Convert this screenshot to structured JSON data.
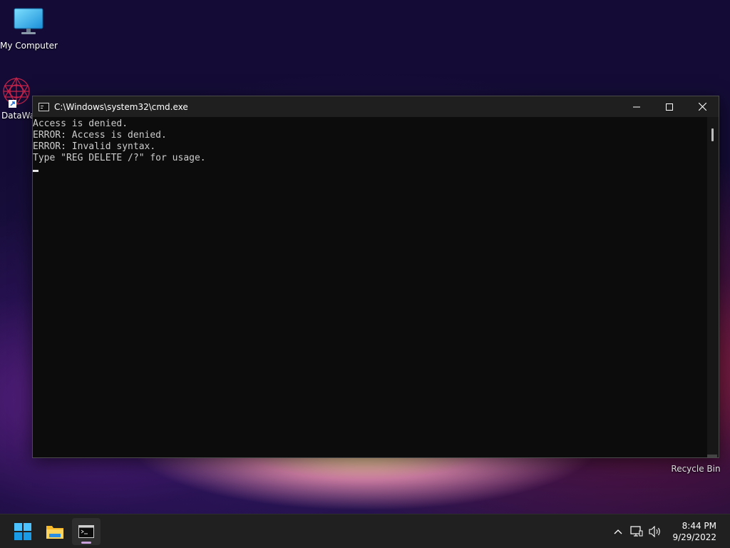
{
  "desktop": {
    "icons": [
      {
        "label": "My Computer"
      },
      {
        "label": "DataWa"
      },
      {
        "label": "Recycle Bin"
      }
    ]
  },
  "cmd_window": {
    "title": "C:\\Windows\\system32\\cmd.exe",
    "lines": [
      "Access is denied.",
      "ERROR: Access is denied.",
      "ERROR: Invalid syntax.",
      "Type \"REG DELETE /?\" for usage."
    ]
  },
  "taskbar": {
    "apps": [
      {
        "icon": "windows-start-icon"
      },
      {
        "icon": "file-explorer-icon"
      },
      {
        "icon": "cmd-icon",
        "active": true
      }
    ],
    "time": "8:44 PM",
    "date": "9/29/2022"
  },
  "colors": {
    "console_bg": "#0c0c0c",
    "console_text": "#cccccc",
    "taskbar_bg": "#202020"
  }
}
